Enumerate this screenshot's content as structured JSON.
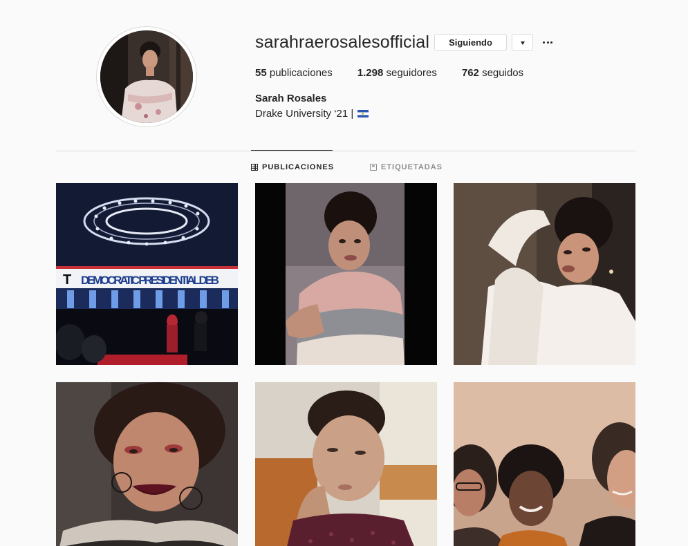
{
  "profile": {
    "username": "sarahraerosalesofficial",
    "follow_label": "Siguiendo",
    "stats": {
      "posts_count": "55",
      "posts_label": "publicaciones",
      "followers_count": "1.298",
      "followers_label": "seguidores",
      "following_count": "762",
      "following_label": "seguidos"
    },
    "full_name": "Sarah Rosales",
    "bio": "Drake University ‘21 |",
    "bio_flag_icon": "el-salvador-flag-icon"
  },
  "tabs": [
    {
      "label": "PUBLICACIONES",
      "icon": "grid-icon",
      "active": true
    },
    {
      "label": "ETIQUETADAS",
      "icon": "tagged-icon",
      "active": false
    }
  ],
  "posts": [
    {
      "kind": "photo",
      "text": "DEMOCRATIC PRESIDENTIAL DEB"
    },
    {
      "kind": "photo"
    },
    {
      "kind": "photo"
    },
    {
      "kind": "photo"
    },
    {
      "kind": "photo"
    },
    {
      "kind": "photo"
    }
  ],
  "colors": {
    "background": "#fafafa",
    "text": "#262626",
    "muted": "#8e8e8e",
    "border": "#dbdbdb"
  }
}
